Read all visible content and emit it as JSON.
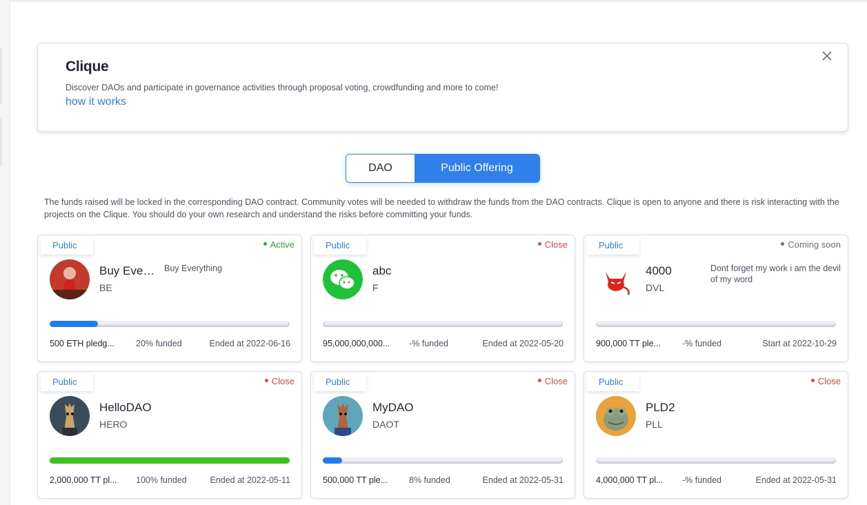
{
  "intro": {
    "title": "Clique",
    "description": "Discover DAOs and participate in governance activities through proposal voting, crowdfunding and more to come!",
    "link": "how it works",
    "close_icon": "close-icon"
  },
  "tabs": [
    {
      "label": "DAO",
      "active": false
    },
    {
      "label": "Public Offering",
      "active": true
    }
  ],
  "notice": "The funds raised will be locked in the corresponding DAO contract. Community votes will be needed to withdraw the funds from the DAO contracts. Clique is open to anyone and there is risk interacting with the projects on the Clique. You should do your own research and understand the risks before committing your funds.",
  "colors": {
    "accent": "#2f80ed",
    "active": "#22b33a",
    "close": "#ef4444",
    "soon": "#6b7280",
    "progress_blue": "#1f7cf0",
    "progress_green": "#3cc21c"
  },
  "cards": [
    {
      "badge": "Public",
      "status": "Active",
      "status_kind": "active",
      "name": "Buy Ever...",
      "symbol": "BE",
      "description": "Buy Everything",
      "raised": "500 ETH pledg...",
      "funded": "20% funded",
      "progress": 0.2,
      "date": "Ended at 2022-06-16",
      "avatar": "red-figure-avatar"
    },
    {
      "badge": "Public",
      "status": "Close",
      "status_kind": "close",
      "name": "abc",
      "symbol": "F",
      "description": "",
      "raised": "95,000,000,000...",
      "funded": "-% funded",
      "progress": 0,
      "date": "Ended at 2022-05-20",
      "avatar": "wechat-avatar"
    },
    {
      "badge": "Public",
      "status": "Coming soon",
      "status_kind": "soon",
      "name": "4000",
      "symbol": "DVL",
      "description": "Dont forget my work i am the devil of my word",
      "raised": "900,000 TT ple...",
      "funded": "-% funded",
      "progress": 0,
      "date": "Start at 2022-10-29",
      "avatar": "devil-avatar"
    },
    {
      "badge": "Public",
      "status": "Close",
      "status_kind": "close",
      "name": "HelloDAO",
      "symbol": "HERO",
      "description": "",
      "raised": "2,000,000 TT pl...",
      "funded": "100% funded",
      "progress": 1.0,
      "date": "Ended at 2022-05-11",
      "avatar": "giraffe-avatar"
    },
    {
      "badge": "Public",
      "status": "Close",
      "status_kind": "close",
      "name": "MyDAO",
      "symbol": "DAOT",
      "description": "",
      "raised": "500,000 TT ple...",
      "funded": "8% funded",
      "progress": 0.08,
      "date": "Ended at 2022-05-31",
      "avatar": "giraffe-avatar-2"
    },
    {
      "badge": "Public",
      "status": "Close",
      "status_kind": "close",
      "name": "PLD2",
      "symbol": "PLL",
      "description": "",
      "raised": "4,000,000 TT pl...",
      "funded": "-% funded",
      "progress": 0,
      "date": "Ended at 2022-05-31",
      "avatar": "frog-avatar"
    }
  ]
}
